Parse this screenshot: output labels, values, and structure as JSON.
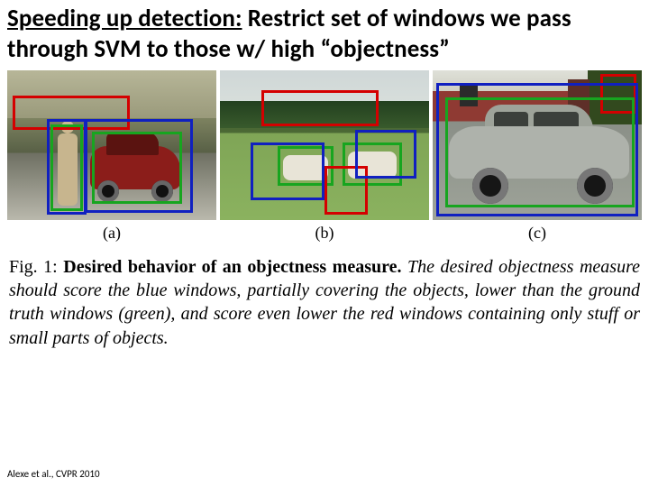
{
  "title": {
    "underlined": "Speeding up detection:",
    "rest": " Restrict set of windows we pass through SVM to those w/ high “objectness”"
  },
  "figure": {
    "panels": [
      {
        "label": "(a)"
      },
      {
        "label": "(b)"
      },
      {
        "label": "(c)"
      }
    ]
  },
  "caption": {
    "lead_label": "Fig. 1: ",
    "lead_bold": "Desired behavior of an objectness measure.",
    "body": " The desired objectness measure should score the blue windows, partially covering the objects, lower than the ground truth windows (green), and score even lower the red windows containing only stuff or small parts of objects."
  },
  "citation": "Alexe et al., CVPR 2010"
}
